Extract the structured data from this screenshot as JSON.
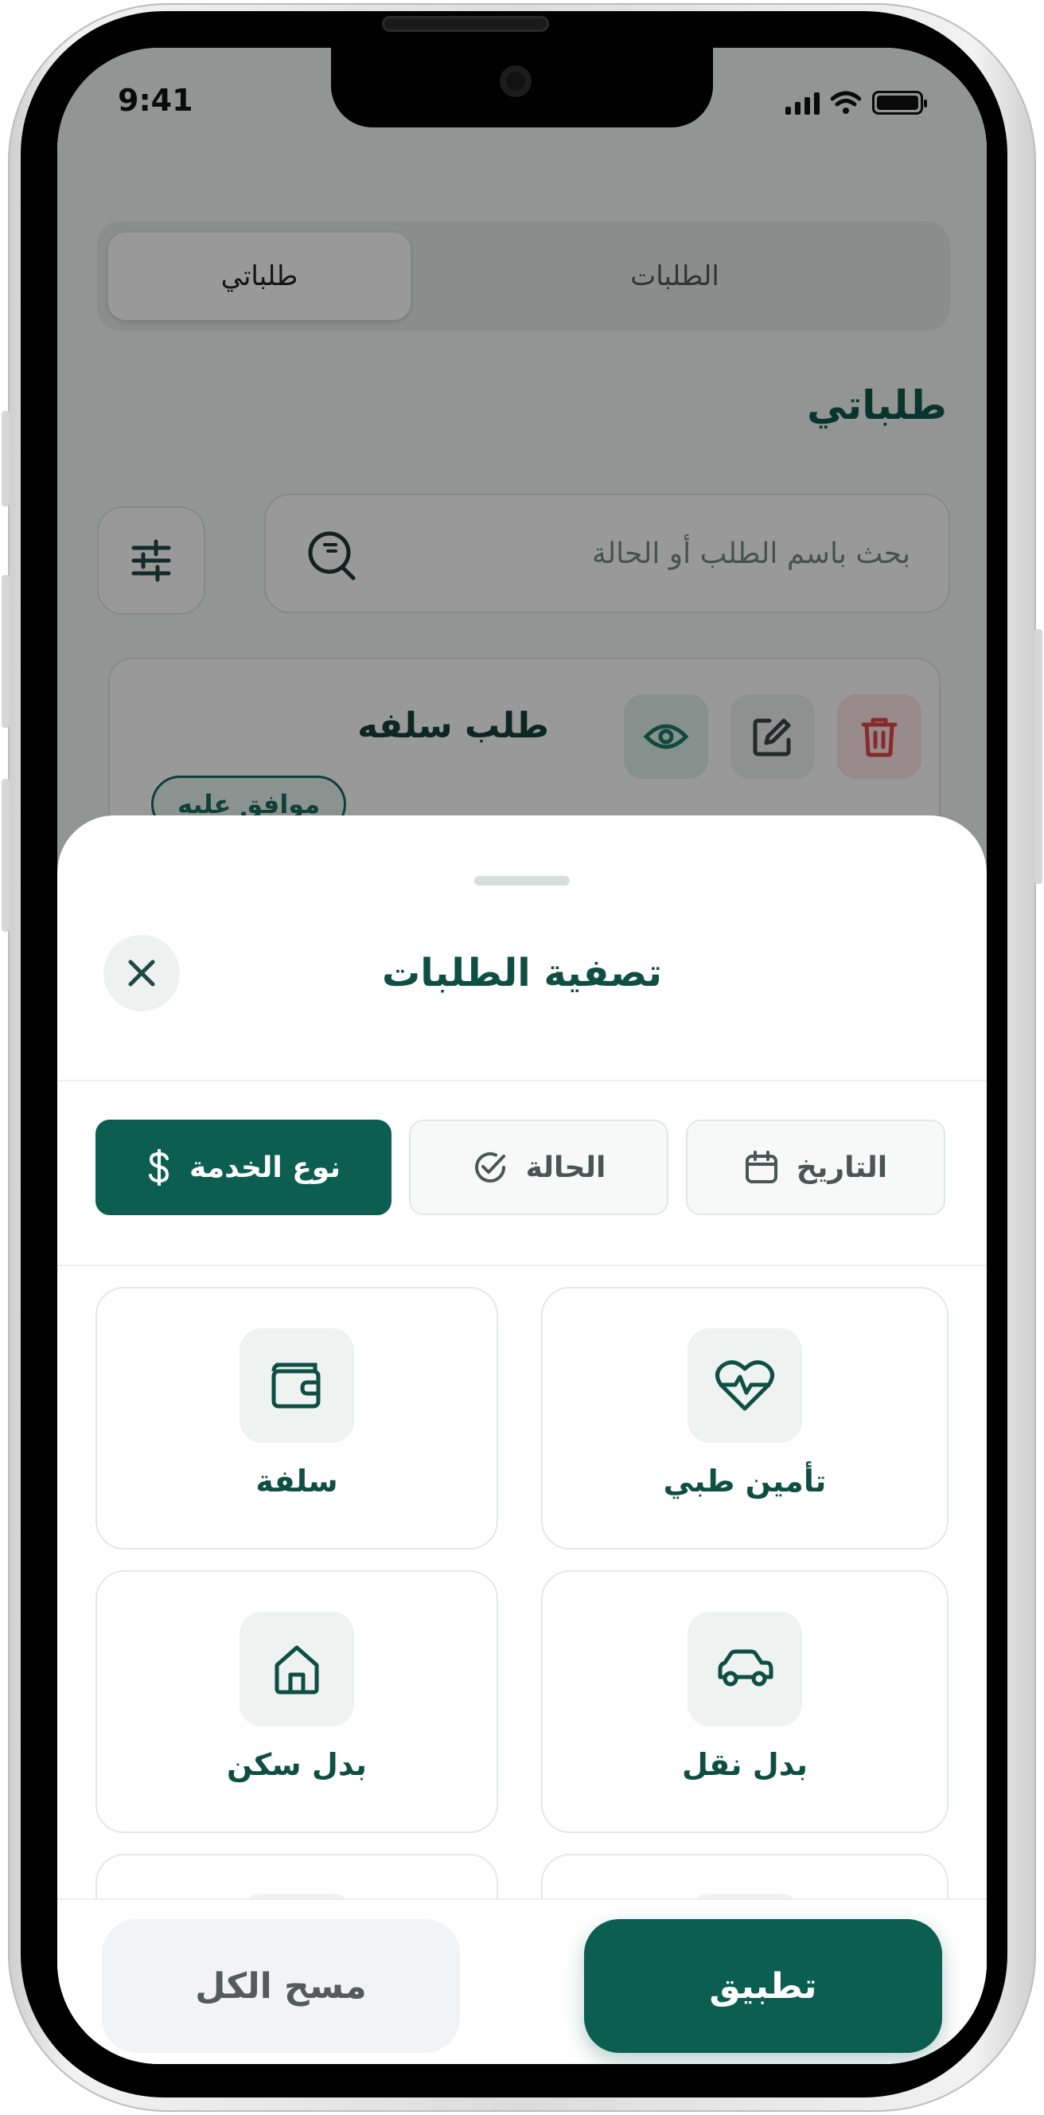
{
  "status_bar": {
    "time": "9:41"
  },
  "segmented": {
    "tab_requests": "الطلبات",
    "tab_my_requests": "طلباتي",
    "active": "طلباتي"
  },
  "page": {
    "heading": "طلباتي"
  },
  "search": {
    "placeholder": "بحث باسم الطلب أو الحالة"
  },
  "request_card": {
    "title": "طلب سلفه",
    "status": "موافق عليه"
  },
  "sheet": {
    "title": "تصفية الطلبات",
    "tabs": [
      {
        "label": "التاريخ",
        "icon": "calendar-icon",
        "active": false
      },
      {
        "label": "الحالة",
        "icon": "check-circle-icon",
        "active": false
      },
      {
        "label": "نوع الخدمة",
        "icon": "dollar-icon",
        "active": true
      }
    ],
    "services": [
      {
        "label": "تأمين طبي",
        "icon": "heart-pulse-icon"
      },
      {
        "label": "سلفة",
        "icon": "wallet-icon"
      },
      {
        "label": "بدل نقل",
        "icon": "car-icon"
      },
      {
        "label": "بدل سكن",
        "icon": "home-icon"
      }
    ],
    "apply_label": "تطبيق",
    "clear_label": "مسح الكل"
  },
  "colors": {
    "brand": "#0c5f50",
    "brand_dark_text": "#0f4f43",
    "danger": "#e04848"
  }
}
